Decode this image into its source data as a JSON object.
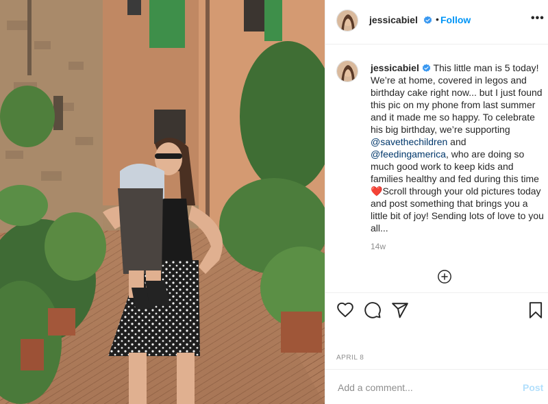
{
  "post": {
    "username": "jessicabiel",
    "verified": true,
    "follow_label": "Follow",
    "more_label": "•••",
    "separator": "•"
  },
  "caption": {
    "username": "jessicabiel",
    "part1": " This little man is 5 today! We’re at home, covered in legos and birthday cake right now... but I just found this pic on my phone from last summer and it made me so happy. To celebrate his big birthday, we’re supporting ",
    "mention1": "@savethechildren",
    "part2": " and ",
    "mention2": "@feedingamerica",
    "part3": ", who are doing so much good work to keep kids and families healthy and fed during this time ",
    "emoji": "❤️",
    "part4": "Scroll through your old pictures today and post something that brings you a little bit of joy! Sending lots of love to you all...",
    "time": "14w"
  },
  "icons": {
    "like": "heart-icon",
    "comment": "comment-bubble-icon",
    "share": "paper-plane-icon",
    "save": "bookmark-icon",
    "load_more": "plus-circle-icon"
  },
  "date_label": "APRIL 8",
  "comment_box": {
    "placeholder": "Add a comment...",
    "post_label": "Post"
  },
  "colors": {
    "link": "#0095f6",
    "mention": "#00376b",
    "post_disabled": "#b2dffc",
    "muted": "#8e8e8e"
  }
}
